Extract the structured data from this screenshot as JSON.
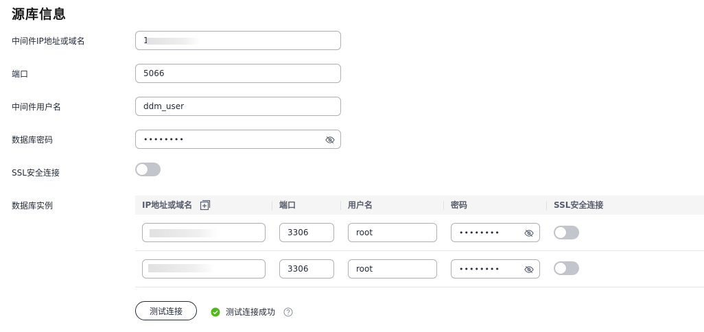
{
  "section_title": "源库信息",
  "fields": {
    "middleware_ip": {
      "label": "中间件IP地址或域名",
      "value": "1"
    },
    "port": {
      "label": "端口",
      "value": "5066"
    },
    "middleware_user": {
      "label": "中间件用户名",
      "value": "ddm_user"
    },
    "db_password": {
      "label": "数据库密码",
      "value": "••••••••"
    },
    "ssl": {
      "label": "SSL安全连接",
      "enabled": false
    }
  },
  "instances": {
    "label": "数据库实例",
    "columns": [
      "IP地址或域名",
      "端口",
      "用户名",
      "密码",
      "SSL安全连接"
    ],
    "rows": [
      {
        "ip": "",
        "port": "3306",
        "user": "root",
        "password": "••••••••",
        "ssl": false
      },
      {
        "ip": "",
        "port": "3306",
        "user": "root",
        "password": "••••••••",
        "ssl": false
      }
    ]
  },
  "test_button": "测试连接",
  "test_status": "测试连接成功",
  "colors": {
    "success": "#50b91a",
    "border": "#adb0b8",
    "toggle_off": "#c2c5cc"
  },
  "icons": [
    "add-icon",
    "eye-off-icon",
    "check-circle-icon",
    "help-icon"
  ]
}
